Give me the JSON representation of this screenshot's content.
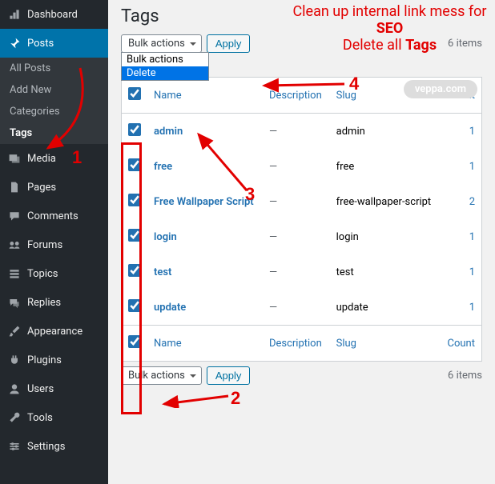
{
  "sidebar": {
    "dashboard": "Dashboard",
    "posts": "Posts",
    "posts_sub": {
      "all": "All Posts",
      "add": "Add New",
      "categories": "Categories",
      "tags": "Tags"
    },
    "media": "Media",
    "pages": "Pages",
    "comments": "Comments",
    "forums": "Forums",
    "topics": "Topics",
    "replies": "Replies",
    "appearance": "Appearance",
    "plugins": "Plugins",
    "users": "Users",
    "tools": "Tools",
    "settings": "Settings"
  },
  "page": {
    "title": "Tags",
    "items_count": "6 items"
  },
  "bulk": {
    "label": "Bulk actions",
    "options": {
      "bulk": "Bulk actions",
      "delete": "Delete"
    },
    "apply": "Apply"
  },
  "columns": {
    "name": "Name",
    "desc": "Description",
    "slug": "Slug",
    "count": "Count"
  },
  "rows": [
    {
      "name": "admin",
      "desc": "—",
      "slug": "admin",
      "count": "1"
    },
    {
      "name": "free",
      "desc": "—",
      "slug": "free",
      "count": "1"
    },
    {
      "name": "Free Wallpaper Script",
      "desc": "—",
      "slug": "free-wallpaper-script",
      "count": "2"
    },
    {
      "name": "login",
      "desc": "—",
      "slug": "login",
      "count": "1"
    },
    {
      "name": "test",
      "desc": "—",
      "slug": "test",
      "count": "1"
    },
    {
      "name": "update",
      "desc": "—",
      "slug": "update",
      "count": "1"
    }
  ],
  "annotation": {
    "headline_html": "Clean up internal link mess for <b>SEO</b><br>Delete all <b>Tags</b>",
    "n1": "1",
    "n2": "2",
    "n3": "3",
    "n4": "4",
    "watermark": "veppa.com"
  }
}
